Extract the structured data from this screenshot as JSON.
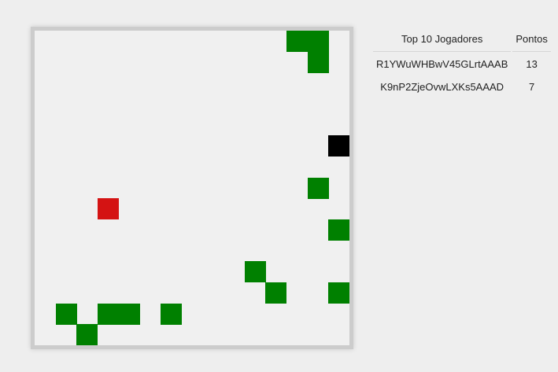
{
  "game": {
    "grid": {
      "cols": 15,
      "rows": 15
    },
    "colors": {
      "fruit": "#008000",
      "current_player": "#000000",
      "other_player": "#d41313",
      "background": "#f0f0f0"
    },
    "fruits": [
      [
        12,
        0
      ],
      [
        13,
        0
      ],
      [
        13,
        1
      ],
      [
        13,
        7
      ],
      [
        14,
        9
      ],
      [
        10,
        11
      ],
      [
        11,
        12
      ],
      [
        14,
        12
      ],
      [
        1,
        13
      ],
      [
        3,
        13
      ],
      [
        4,
        13
      ],
      [
        6,
        13
      ],
      [
        2,
        14
      ]
    ],
    "current_player": [
      14,
      5
    ],
    "other_players": [
      [
        3,
        8
      ]
    ]
  },
  "scoreboard": {
    "header_players": "Top 10 Jogadores",
    "header_points": "Pontos",
    "rows": [
      {
        "player": "R1YWuWHBwV45GLrtAAAB",
        "points": "13"
      },
      {
        "player": "K9nP2ZjeOvwLXKs5AAAD",
        "points": "7"
      }
    ]
  }
}
